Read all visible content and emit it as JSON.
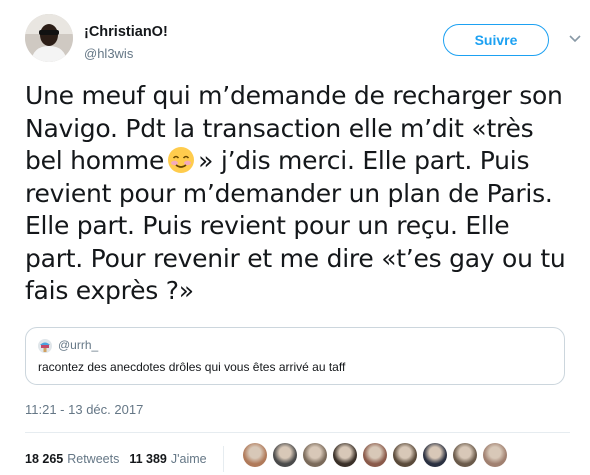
{
  "header": {
    "display_name": "¡ChristianO!",
    "handle": "@hl3wis",
    "follow_label": "Suivre"
  },
  "tweet": {
    "text_before_emoji": "Une meuf qui m’demande de recharger son Navigo. Pdt la transaction elle m’dit «très bel homme",
    "emoji": "smiling-face-with-smiling-eyes-icon",
    "text_after_emoji": "» j’dis merci. Elle part. Puis revient pour m’demander un plan de Paris. Elle part. Puis revient pour un reçu. Elle part. Pour revenir et me dire «t’es gay ou tu fais exprès ?»",
    "timestamp": "11:21 - 13 déc. 2017"
  },
  "quoted_tweet": {
    "handle": "@urrh_",
    "text": "racontez des anecdotes drôles qui vous êtes arrivé au taff"
  },
  "stats": {
    "retweets_count": "18 265",
    "retweets_label": "Retweets",
    "likes_count": "11 389",
    "likes_label": "J'aime"
  },
  "likers": [
    {
      "color": "#b07a5a"
    },
    {
      "color": "#4a4a4a"
    },
    {
      "color": "#7a6a5a"
    },
    {
      "color": "#3a3028"
    },
    {
      "color": "#8a5a4a"
    },
    {
      "color": "#5a4a3a"
    },
    {
      "color": "#2a3040"
    },
    {
      "color": "#6a5a4a"
    },
    {
      "color": "#a08070"
    }
  ],
  "colors": {
    "accent": "#1da1f2",
    "text": "#14171a",
    "muted": "#657786",
    "border": "#ccd6dd"
  }
}
